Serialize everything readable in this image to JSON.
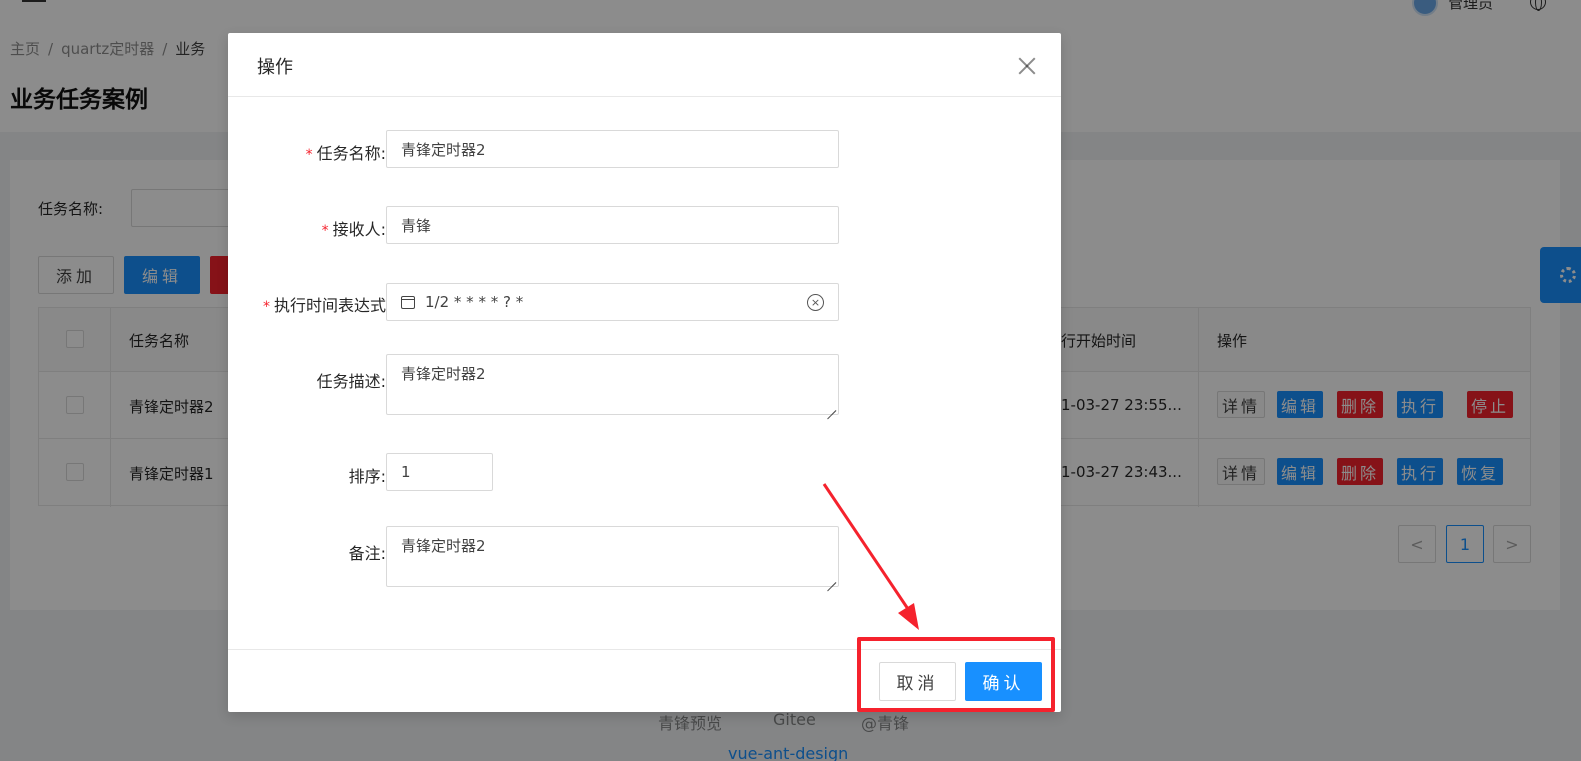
{
  "header": {
    "user_name": "管理员"
  },
  "breadcrumb": [
    "主页",
    "quartz定时器",
    "业务"
  ],
  "breadcrumb_sep": "/",
  "page_title": "业务任务案例",
  "search": {
    "label": "任务名称:",
    "value": ""
  },
  "toolbar": {
    "add_label": "添加",
    "edit_label": "编辑"
  },
  "table": {
    "columns": [
      "任务名称",
      "行开始时间",
      "操作"
    ],
    "rows": [
      {
        "name": "青锋定时器2",
        "start_time": "1-03-27 23:55...",
        "actions": [
          "详情",
          "编辑",
          "删除",
          "执行",
          "停止"
        ]
      },
      {
        "name": "青锋定时器1",
        "start_time": "1-03-27 23:43...",
        "actions": [
          "详情",
          "编辑",
          "删除",
          "执行",
          "恢复"
        ]
      }
    ]
  },
  "pagination": {
    "prev": "<",
    "current": "1",
    "next": ">"
  },
  "footer": {
    "links": [
      "青锋预览",
      "Gitee",
      "@青锋"
    ],
    "sub": "vue-ant-design"
  },
  "modal": {
    "title": "操作",
    "required_mark": "*",
    "fields": {
      "task_name": {
        "label": "任务名称:",
        "value": "青锋定时器2"
      },
      "receiver": {
        "label": "接收人:",
        "value": "青锋"
      },
      "cron": {
        "label": "执行时间表达式",
        "value": "1/2 * * * * ? *"
      },
      "description": {
        "label": "任务描述:",
        "value": "青锋定时器2"
      },
      "order": {
        "label": "排序:",
        "value": "1"
      },
      "remark": {
        "label": "备注:",
        "value": "青锋定时器2"
      }
    },
    "cancel_label": "取消",
    "ok_label": "确认"
  },
  "colors": {
    "primary": "#1890ff",
    "danger": "#f5222d",
    "annotation": "#f5222d"
  }
}
